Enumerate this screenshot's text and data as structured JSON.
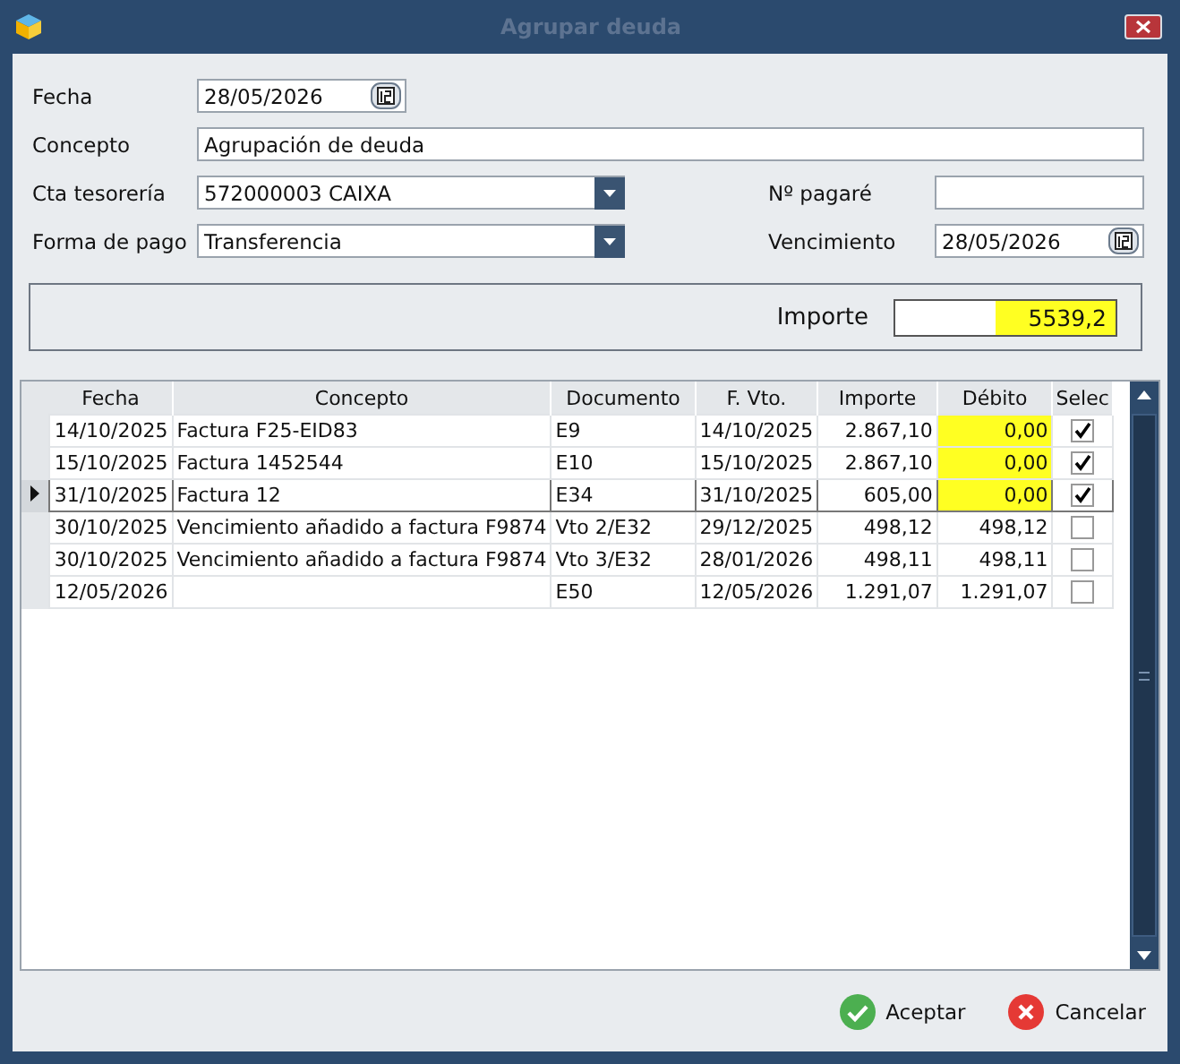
{
  "window": {
    "title": "Agrupar deuda"
  },
  "form": {
    "fecha": {
      "label": "Fecha",
      "value": "28/05/2026"
    },
    "concepto": {
      "label": "Concepto",
      "value": "Agrupación de deuda"
    },
    "cta": {
      "label": "Cta tesorería",
      "value": "572000003 CAIXA"
    },
    "pagare": {
      "label": "Nº pagaré"
    },
    "forma": {
      "label": "Forma de pago",
      "value": "Transferencia"
    },
    "vencimiento": {
      "label": "Vencimiento",
      "value": "28/05/2026"
    }
  },
  "importe": {
    "label": "Importe",
    "value": "5539,2"
  },
  "table": {
    "columns": [
      "Fecha",
      "Concepto",
      "Documento",
      "F. Vto.",
      "Importe",
      "Débito",
      "Selec"
    ],
    "rows": [
      {
        "fecha": "14/10/2025",
        "concepto": "Factura F25-EID83",
        "documento": "E9",
        "vto": "14/10/2025",
        "importe": "2.867,10",
        "debito": "0,00",
        "checked": true,
        "selected": false
      },
      {
        "fecha": "15/10/2025",
        "concepto": "Factura 1452544",
        "documento": "E10",
        "vto": "15/10/2025",
        "importe": "2.867,10",
        "debito": "0,00",
        "checked": true,
        "selected": false
      },
      {
        "fecha": "31/10/2025",
        "concepto": "Factura 12",
        "documento": "E34",
        "vto": "31/10/2025",
        "importe": "605,00",
        "debito": "0,00",
        "checked": true,
        "selected": true
      },
      {
        "fecha": "30/10/2025",
        "concepto": "Vencimiento añadido a factura F9874",
        "documento": "Vto 2/E32",
        "vto": "29/12/2025",
        "importe": "498,12",
        "debito": "498,12",
        "checked": false,
        "selected": false
      },
      {
        "fecha": "30/10/2025",
        "concepto": "Vencimiento añadido a factura F9874",
        "documento": "Vto 3/E32",
        "vto": "28/01/2026",
        "importe": "498,11",
        "debito": "498,11",
        "checked": false,
        "selected": false
      },
      {
        "fecha": "12/05/2026",
        "documento": "E50",
        "vto": "12/05/2026",
        "importe": "1.291,07",
        "debito": "1.291,07",
        "checked": false,
        "selected": false
      }
    ]
  },
  "buttons": {
    "accept": "Aceptar",
    "cancel": "Cancelar"
  }
}
